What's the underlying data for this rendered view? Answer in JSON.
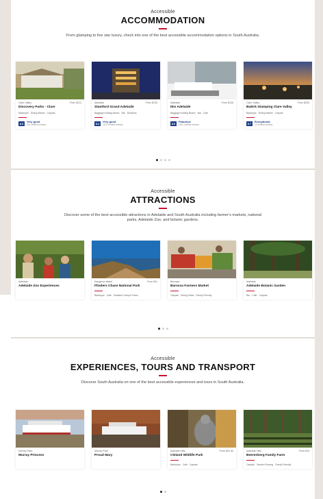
{
  "accommodation": {
    "pre": "Accessible",
    "heading": "ACCOMMODATION",
    "description": "From glamping to five star luxury, check into one of the best accessible accommodation options in South Australia.",
    "cards": [
      {
        "region": "Clare Valley",
        "price": "From $211",
        "name": "Discovery Parks - Clare",
        "tags": [
          "Barbeque",
          "Dining Market",
          "Carpark"
        ],
        "score": "8.3",
        "rating": "Very good",
        "reviews": "214 verified reviews"
      },
      {
        "region": "Adelaide",
        "price": "From $135",
        "name": "Stamford Grand Adelaide",
        "tags": [
          "Baggage Holding Beach",
          "Bar",
          "Business"
        ],
        "score": "8.2",
        "rating": "Very good",
        "reviews": "1123 verified reviews"
      },
      {
        "region": "Adelaide",
        "price": "From $135",
        "name": "Ibis Adelaide",
        "tags": [
          "Baggage Holding Beach",
          "Bar",
          "Cafe"
        ],
        "score": "8.6",
        "rating": "Fabulous",
        "reviews": "1601 verified reviews"
      },
      {
        "region": "Clare Valley",
        "price": "From $205",
        "name": "Bukirk Glamping Clare Valley",
        "tags": [
          "Barbeque",
          "Dining Market",
          "Carpark"
        ],
        "score": "9.7",
        "rating": "Exceptional",
        "reviews": "12 verified reviews"
      }
    ]
  },
  "attractions": {
    "pre": "Accessible",
    "heading": "ATTRACTIONS",
    "description": "Discover some of the best accessible attractions in Adelaide and South Australia including farmer's markets, national parks, Adelaide Zoo, and botanic gardens.",
    "cards": [
      {
        "region": "Adelaide",
        "price": "",
        "name": "Adelaide Zoo Experiences",
        "tags": []
      },
      {
        "region": "Kangaroo Island",
        "price": "From $11",
        "name": "Flinders Chase National Park",
        "tags": [
          "Barbeque",
          "Cafe",
          "Disabled Camper Parks"
        ]
      },
      {
        "region": "Barossa",
        "price": "",
        "name": "Barossa Farmers Market",
        "tags": [
          "Carpark",
          "Dining Seats",
          "Family Friendly"
        ]
      },
      {
        "region": "Adelaide",
        "price": "",
        "name": "Adelaide Botanic Garden",
        "tags": [
          "Bar",
          "Cafe",
          "Carpark"
        ]
      }
    ]
  },
  "experiences": {
    "pre": "Accessible",
    "heading": "EXPERIENCES, TOURS AND TRANSPORT",
    "description": "Discover South Australia on one of the best accessible experiences and tours in South Australia.",
    "cards": [
      {
        "region": "Murray River",
        "price": "",
        "name": "Murray Princess",
        "tags": []
      },
      {
        "region": "Murray River",
        "price": "",
        "name": "Proud Mary",
        "tags": []
      },
      {
        "region": "Adelaide Hills",
        "price": "From $22.50",
        "name": "Cleland Wildlife Park",
        "tags": [
          "Barbeque",
          "Cafe",
          "Carpark"
        ]
      },
      {
        "region": "Adelaide Hills",
        "price": "From $15",
        "name": "Beerenberg Family Farm",
        "tags": [
          "Carpark",
          "Dessert Serving",
          "Family Friendly"
        ]
      }
    ]
  },
  "colors": {
    "accent": "#c8102e",
    "rating": "#1c3f8a"
  }
}
